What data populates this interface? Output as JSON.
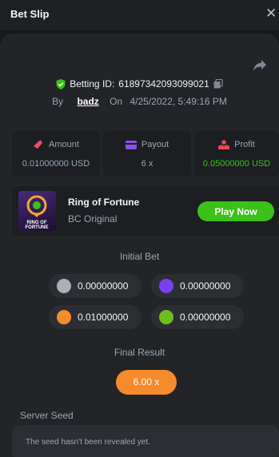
{
  "header": {
    "title": "Bet Slip",
    "close_icon": "close-icon"
  },
  "bet": {
    "betting_id_label": "Betting ID:",
    "betting_id": "61897342093099021",
    "by_label": "By",
    "user": "badz",
    "on_label": "On",
    "date": "4/25/2022, 5:49:16 PM"
  },
  "stats": {
    "amount": {
      "label": "Amount",
      "value": "0.01000000 USD"
    },
    "payout": {
      "label": "Payout",
      "value": "6 x"
    },
    "profit": {
      "label": "Profit",
      "value": "0.05000000 USD",
      "color": "#3bc117"
    }
  },
  "game": {
    "name": "Ring of Fortune",
    "subtitle": "BC Original",
    "thumb_text": "RING OF FORTUNE",
    "play_label": "Play Now"
  },
  "initial_bet": {
    "title": "Initial Bet",
    "coins": [
      {
        "value": "0.00000000",
        "color": "#a9b0b8"
      },
      {
        "value": "0.00000000",
        "color": "#7a3ff0"
      },
      {
        "value": "0.01000000",
        "color": "#f68b2c"
      },
      {
        "value": "0.00000000",
        "color": "#6cbf1a"
      }
    ]
  },
  "final_result": {
    "title": "Final Result",
    "value": "6.00 x"
  },
  "server_seed": {
    "label": "Server Seed",
    "message": "The seed hasn't been revealed yet."
  }
}
